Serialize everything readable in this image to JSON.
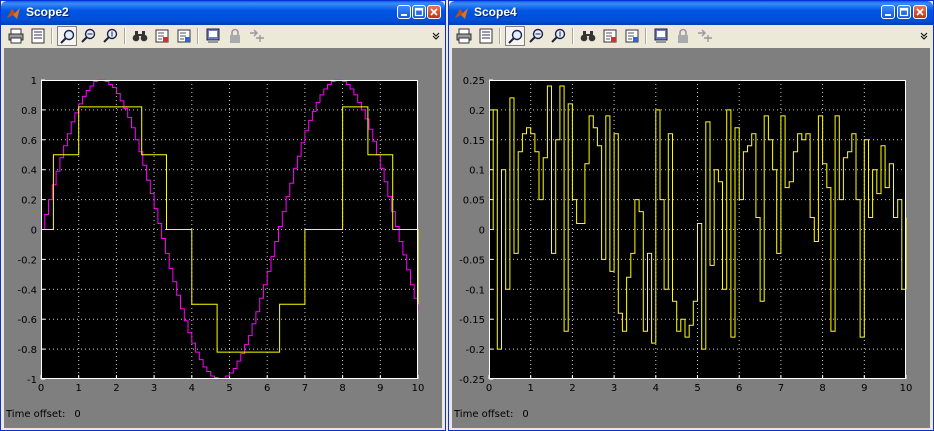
{
  "windows": [
    {
      "title": "Scope2",
      "time_offset_label": "Time offset:",
      "time_offset_value": "0",
      "toolbar_icons": [
        "print-icon",
        "parameters-icon",
        "zoom-icon",
        "zoom-x-icon",
        "zoom-y-icon",
        "autoscale-icon",
        "save-axes-icon",
        "restore-axes-icon",
        "floating-scope-icon",
        "lock-icon",
        "signal-selection-icon"
      ]
    },
    {
      "title": "Scope4",
      "time_offset_label": "Time offset:",
      "time_offset_value": "0",
      "toolbar_icons": [
        "print-icon",
        "parameters-icon",
        "zoom-icon",
        "zoom-x-icon",
        "zoom-y-icon",
        "autoscale-icon",
        "save-axes-icon",
        "restore-axes-icon",
        "floating-scope-icon",
        "lock-icon",
        "signal-selection-icon"
      ]
    }
  ],
  "colors": {
    "plot_background": "#000000",
    "figure_background": "#7f7f7f",
    "grid": "#ffffff",
    "yellow": "#ffff00",
    "magenta": "#ff00ff"
  },
  "chart_data": [
    {
      "type": "line",
      "title": "",
      "xlabel": "",
      "ylabel": "",
      "xlim": [
        0,
        10
      ],
      "ylim": [
        -1,
        1
      ],
      "grid": true,
      "xticks": [
        "0",
        "1",
        "2",
        "3",
        "4",
        "5",
        "6",
        "7",
        "8",
        "9",
        "10"
      ],
      "yticks": [
        "1",
        "0.8",
        "0.6",
        "0.4",
        "0.2",
        "0",
        "-0.2",
        "-0.4",
        "-0.6",
        "-0.8",
        "-1"
      ],
      "series": [
        {
          "color": "#ff00ff",
          "step": true,
          "x": [
            0,
            0.1,
            0.2,
            0.3,
            0.4,
            0.5,
            0.6,
            0.7,
            0.8,
            0.9,
            1.0,
            1.1,
            1.2,
            1.3,
            1.4,
            1.5,
            1.6,
            1.7,
            1.8,
            1.9,
            2.0,
            2.1,
            2.2,
            2.3,
            2.4,
            2.5,
            2.6,
            2.7,
            2.8,
            2.9,
            3.0,
            3.1,
            3.2,
            3.3,
            3.4,
            3.5,
            3.6,
            3.7,
            3.8,
            3.9,
            4.0,
            4.1,
            4.2,
            4.3,
            4.4,
            4.5,
            4.6,
            4.7,
            4.8,
            4.9,
            5.0,
            5.1,
            5.2,
            5.3,
            5.4,
            5.5,
            5.6,
            5.7,
            5.8,
            5.9,
            6.0,
            6.1,
            6.2,
            6.3,
            6.4,
            6.5,
            6.6,
            6.7,
            6.8,
            6.9,
            7.0,
            7.1,
            7.2,
            7.3,
            7.4,
            7.5,
            7.6,
            7.7,
            7.8,
            7.9,
            8.0,
            8.1,
            8.2,
            8.3,
            8.4,
            8.5,
            8.6,
            8.7,
            8.8,
            8.9,
            9.0,
            9.1,
            9.2,
            9.3,
            9.4,
            9.5,
            9.6,
            9.7,
            9.8,
            9.9,
            10.0
          ],
          "values": [
            0,
            0.1,
            0.2,
            0.3,
            0.39,
            0.48,
            0.56,
            0.64,
            0.72,
            0.78,
            0.84,
            0.89,
            0.93,
            0.96,
            0.99,
            1.0,
            1.0,
            0.99,
            0.97,
            0.95,
            0.91,
            0.86,
            0.81,
            0.75,
            0.68,
            0.6,
            0.52,
            0.43,
            0.33,
            0.24,
            0.14,
            0.04,
            -0.06,
            -0.16,
            -0.26,
            -0.35,
            -0.44,
            -0.53,
            -0.61,
            -0.69,
            -0.76,
            -0.82,
            -0.87,
            -0.92,
            -0.95,
            -0.98,
            -0.99,
            -1.0,
            -1.0,
            -0.98,
            -0.96,
            -0.93,
            -0.88,
            -0.83,
            -0.77,
            -0.71,
            -0.63,
            -0.55,
            -0.46,
            -0.37,
            -0.28,
            -0.18,
            -0.08,
            0.02,
            0.12,
            0.22,
            0.31,
            0.41,
            0.49,
            0.58,
            0.66,
            0.73,
            0.79,
            0.85,
            0.9,
            0.94,
            0.97,
            0.99,
            1.0,
            1.0,
            0.99,
            0.97,
            0.94,
            0.9,
            0.85,
            0.8,
            0.74,
            0.67,
            0.59,
            0.5,
            0.41,
            0.32,
            0.22,
            0.12,
            0.02,
            -0.08,
            -0.17,
            -0.27,
            -0.37,
            -0.46,
            -0.54
          ]
        },
        {
          "color": "#ffff00",
          "step": true,
          "x": [
            0,
            0.33,
            1.0,
            2.0,
            2.67,
            3.33,
            4.0,
            4.67,
            5.67,
            6.33,
            7.0,
            8.0,
            8.67,
            9.33,
            10.0
          ],
          "values": [
            0,
            0.5,
            0.82,
            0.82,
            0.5,
            0,
            -0.5,
            -0.82,
            -0.82,
            -0.5,
            0,
            0.82,
            0.5,
            0,
            -0.5
          ]
        }
      ]
    },
    {
      "type": "line",
      "title": "",
      "xlabel": "",
      "ylabel": "",
      "xlim": [
        0,
        10
      ],
      "ylim": [
        -0.25,
        0.25
      ],
      "grid": true,
      "xticks": [
        "0",
        "1",
        "2",
        "3",
        "4",
        "5",
        "6",
        "7",
        "8",
        "9",
        "10"
      ],
      "yticks": [
        "0.25",
        "0.2",
        "0.15",
        "0.1",
        "0.05",
        "0",
        "-0.05",
        "-0.1",
        "-0.15",
        "-0.2",
        "-0.25"
      ],
      "series": [
        {
          "color": "#ffff00",
          "step": true,
          "x": [
            0,
            0.1,
            0.2,
            0.3,
            0.4,
            0.5,
            0.6,
            0.7,
            0.8,
            0.9,
            1.0,
            1.1,
            1.2,
            1.3,
            1.4,
            1.5,
            1.6,
            1.7,
            1.8,
            1.9,
            2.0,
            2.1,
            2.2,
            2.3,
            2.4,
            2.5,
            2.6,
            2.7,
            2.8,
            2.9,
            3.0,
            3.1,
            3.2,
            3.3,
            3.4,
            3.5,
            3.6,
            3.7,
            3.8,
            3.9,
            4.0,
            4.1,
            4.2,
            4.3,
            4.4,
            4.5,
            4.6,
            4.7,
            4.8,
            4.9,
            5.0,
            5.1,
            5.2,
            5.3,
            5.4,
            5.5,
            5.6,
            5.7,
            5.8,
            5.9,
            6.0,
            6.1,
            6.2,
            6.3,
            6.4,
            6.5,
            6.6,
            6.7,
            6.8,
            6.9,
            7.0,
            7.1,
            7.2,
            7.3,
            7.4,
            7.5,
            7.6,
            7.7,
            7.8,
            7.9,
            8.0,
            8.1,
            8.2,
            8.3,
            8.4,
            8.5,
            8.6,
            8.7,
            8.8,
            8.9,
            9.0,
            9.1,
            9.2,
            9.3,
            9.4,
            9.5,
            9.6,
            9.7,
            9.8,
            9.9,
            10.0
          ],
          "values": [
            0,
            0.2,
            -0.2,
            0.1,
            -0.1,
            0.22,
            -0.04,
            0.13,
            0.16,
            0.17,
            0.16,
            0.13,
            0.05,
            0.12,
            0.24,
            -0.04,
            0.15,
            0.24,
            -0.17,
            0.21,
            0.05,
            0.01,
            0.01,
            0.11,
            0.19,
            0.17,
            0.14,
            -0.05,
            0.19,
            -0.07,
            0.16,
            -0.14,
            -0.17,
            -0.08,
            -0.04,
            0.05,
            0.03,
            -0.17,
            -0.04,
            -0.19,
            0.2,
            0.05,
            -0.1,
            0.16,
            -0.12,
            -0.17,
            -0.15,
            -0.18,
            -0.16,
            -0.12,
            0.01,
            -0.2,
            0.18,
            -0.06,
            0.1,
            0.08,
            -0.1,
            0.2,
            -0.18,
            0.17,
            0.05,
            0.13,
            0.14,
            0.16,
            0.02,
            -0.12,
            0.19,
            0.15,
            0.1,
            -0.04,
            0.19,
            0.07,
            0.08,
            0.13,
            0.16,
            0.15,
            0.16,
            0.02,
            -0.02,
            0.19,
            0.11,
            0.07,
            -0.17,
            0.19,
            0.05,
            0.12,
            0.13,
            0.16,
            0.05,
            -0.18,
            0.15,
            0.02,
            0.1,
            0.06,
            0.14,
            0.07,
            0.11,
            0.02,
            0.05,
            -0.1,
            0.02
          ]
        }
      ]
    }
  ]
}
